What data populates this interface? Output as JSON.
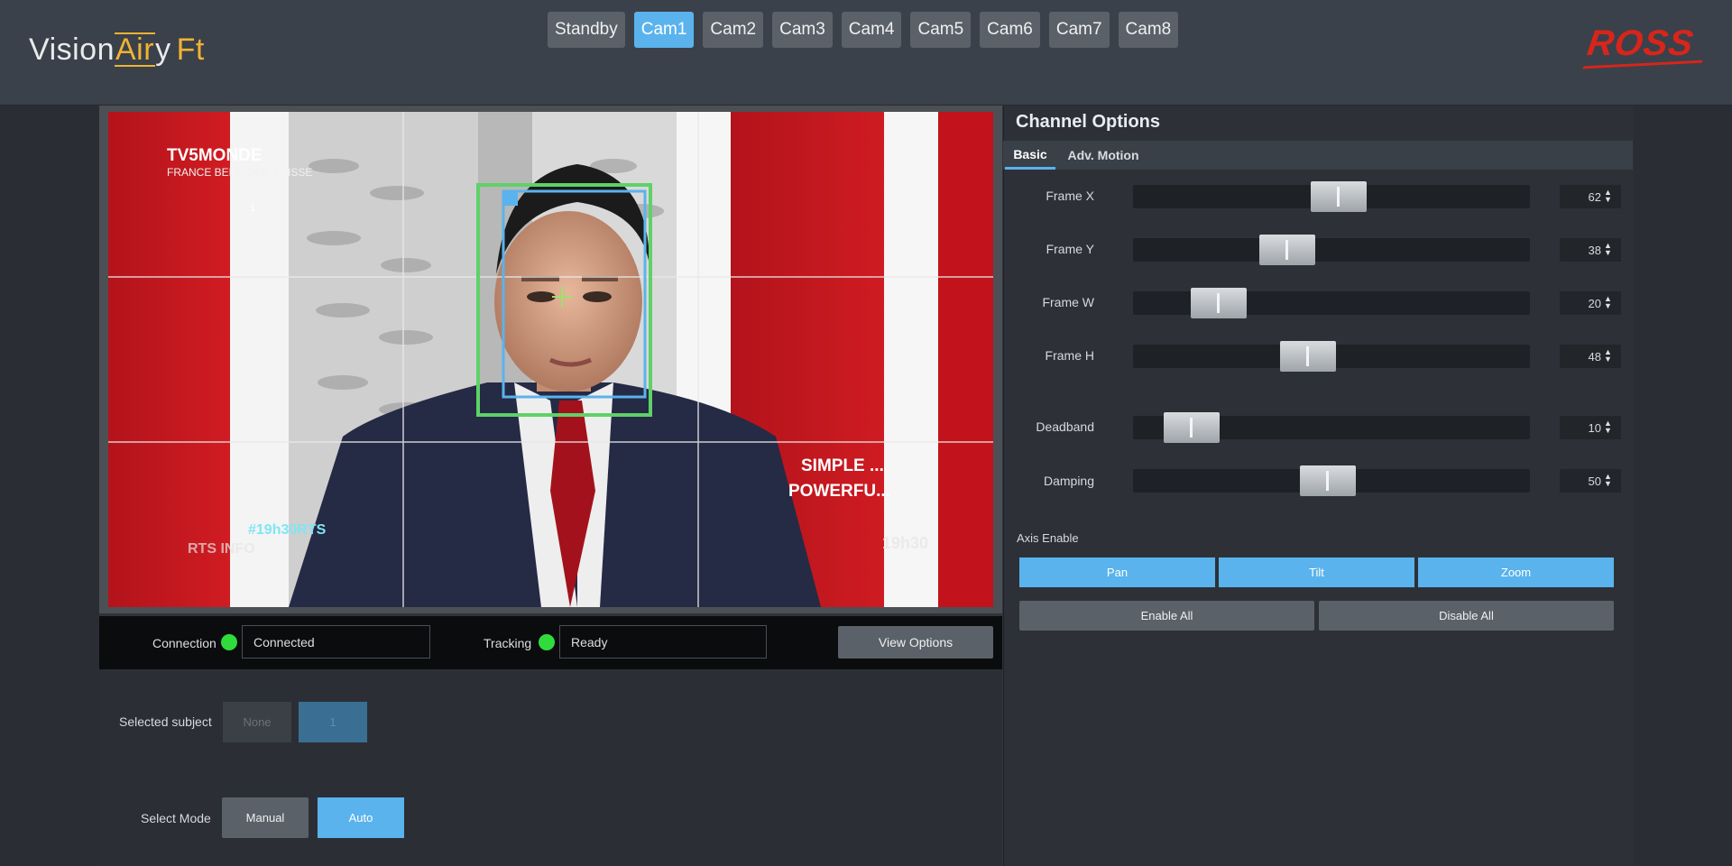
{
  "header": {
    "logo_text": "Vision",
    "logo_air": "Air",
    "logo_y": "y",
    "logo_suffix": "Ft",
    "brand": "ROSS",
    "cameras": [
      "Standby",
      "Cam1",
      "Cam2",
      "Cam3",
      "Cam4",
      "Cam5",
      "Cam6",
      "Cam7",
      "Cam8"
    ],
    "active_camera": "Cam1"
  },
  "video": {
    "channel_logo": "TV5MONDE",
    "channel_sub": "FRANCE BELGIQUE SUISSE",
    "hashtag": "#19h30RTS",
    "rts_info": "RTS INFO",
    "overlay_line1": "SIMPLE ...",
    "overlay_line2": "POWERFU...",
    "show_logo": "19h30",
    "subject_id": "1"
  },
  "status": {
    "connection_label": "Connection",
    "connection_value": "Connected",
    "tracking_label": "Tracking",
    "tracking_value": "Ready",
    "view_options": "View Options"
  },
  "subject": {
    "label": "Selected subject",
    "options": [
      "None",
      "1"
    ]
  },
  "mode": {
    "label": "Select Mode",
    "options": [
      "Manual",
      "Auto"
    ],
    "selected": "Auto"
  },
  "panel": {
    "title": "Channel Options",
    "tabs": [
      "Basic",
      "Adv. Motion"
    ],
    "active_tab": "Basic",
    "sliders": [
      {
        "label": "Frame X",
        "value": "62",
        "fraction": 0.52
      },
      {
        "label": "Frame Y",
        "value": "38",
        "fraction": 0.37
      },
      {
        "label": "Frame W",
        "value": "20",
        "fraction": 0.17
      },
      {
        "label": "Frame H",
        "value": "48",
        "fraction": 0.43
      },
      {
        "label": "Deadband",
        "value": "10",
        "fraction": 0.09
      },
      {
        "label": "Damping",
        "value": "50",
        "fraction": 0.49
      }
    ],
    "axis_label": "Axis Enable",
    "axis_buttons": [
      "Pan",
      "Tilt",
      "Zoom"
    ],
    "enable_all": "Enable All",
    "disable_all": "Disable All"
  }
}
